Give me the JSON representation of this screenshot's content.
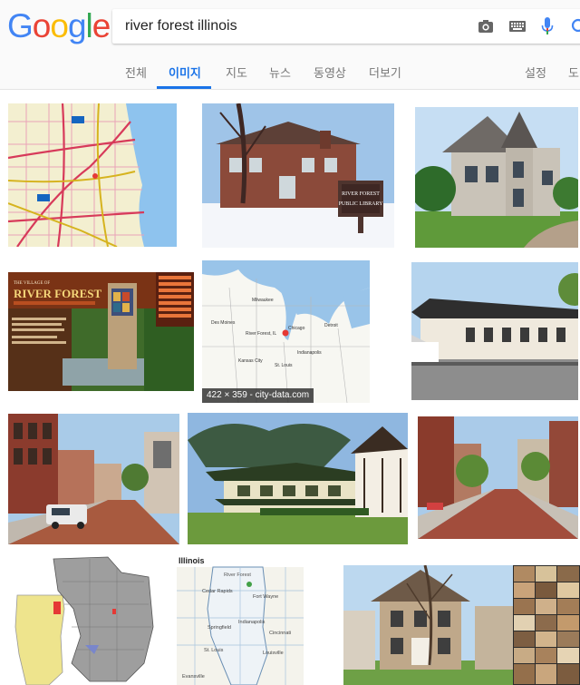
{
  "logo": {
    "letters": [
      "G",
      "o",
      "o",
      "g",
      "l",
      "e"
    ]
  },
  "search": {
    "query": "river forest illinois"
  },
  "tabs": [
    {
      "label": "전체"
    },
    {
      "label": "이미지"
    },
    {
      "label": "지도"
    },
    {
      "label": "뉴스"
    },
    {
      "label": "동영상"
    },
    {
      "label": "더보기"
    }
  ],
  "settings_tab": {
    "label": "설정"
  },
  "tools_tab": {
    "label": "도"
  },
  "results": {
    "row2_map_caption": "422 × 359 - city-data.com",
    "library_sign": {
      "line1": "RIVER FOREST",
      "line2": "PUBLIC LIBRARY"
    },
    "village_site": {
      "small": "THE VILLAGE OF",
      "title": "RIVER FOREST"
    },
    "us_map_labels": {
      "chicago": "Chicago",
      "detroit": "Detroit",
      "river_forest": "River Forest, IL",
      "indianapolis": "Indianapolis",
      "st_louis": "St. Louis",
      "kansas_city": "Kansas City",
      "milwaukee": "Milwaukee",
      "des_moines": "Des Moines"
    },
    "illinois_map": {
      "title": "Illinois",
      "river_forest": "River Forest",
      "cedar_rapids": "Cedar Rapids",
      "fort_wayne": "Fort Wayne",
      "indianapolis": "Indianapolis",
      "springfield": "Springfield",
      "cincinnati": "Cincinnati",
      "st_louis": "St. Louis",
      "louisville": "Louisville",
      "evansville": "Evansville"
    }
  },
  "colors": {
    "blue": "#4285f4",
    "red": "#ea4335",
    "yellow": "#fbbc05",
    "green": "#34a853",
    "accent": "#1a73e8"
  }
}
